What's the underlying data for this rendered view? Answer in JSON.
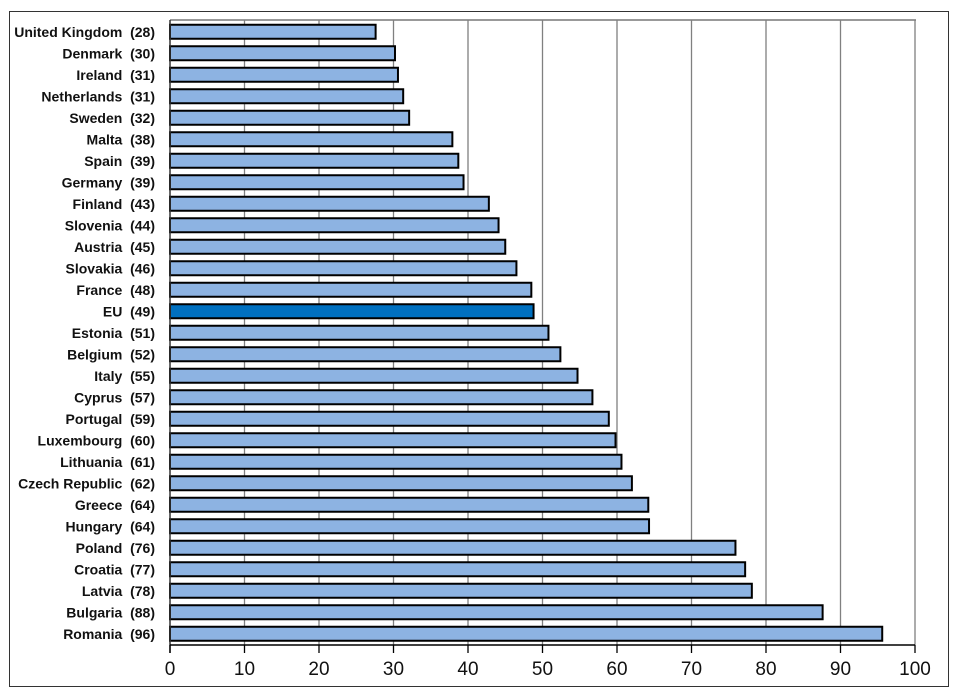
{
  "chart_data": {
    "type": "bar",
    "orientation": "horizontal",
    "title": "",
    "xlabel": "",
    "ylabel": "",
    "xlim": [
      0,
      100
    ],
    "xticks": [
      0,
      10,
      20,
      30,
      40,
      50,
      60,
      70,
      80,
      90,
      100
    ],
    "grid": "vertical",
    "legend": "none",
    "categories": [
      "United Kingdom  (28)",
      "Denmark  (30)",
      "Ireland  (31)",
      "Netherlands  (31)",
      "Sweden  (32)",
      "Malta  (38)",
      "Spain  (39)",
      "Germany  (39)",
      "Finland  (43)",
      "Slovenia  (44)",
      "Austria  (45)",
      "Slovakia  (46)",
      "France  (48)",
      "EU  (49)",
      "Estonia  (51)",
      "Belgium  (52)",
      "Italy  (55)",
      "Cyprus  (57)",
      "Portugal  (59)",
      "Luxembourg  (60)",
      "Lithuania  (61)",
      "Czech Republic  (62)",
      "Greece  (64)",
      "Hungary  (64)",
      "Poland  (76)",
      "Croatia  (77)",
      "Latvia  (78)",
      "Bulgaria  (88)",
      "Romania  (96)"
    ],
    "values": [
      27.6,
      30.2,
      30.6,
      31.3,
      32.1,
      37.9,
      38.7,
      39.4,
      42.8,
      44.1,
      45.0,
      46.5,
      48.5,
      48.8,
      50.8,
      52.4,
      54.7,
      56.7,
      58.9,
      59.8,
      60.6,
      62.0,
      64.2,
      64.3,
      75.9,
      77.2,
      78.1,
      87.6,
      95.6
    ],
    "highlight": "EU  (49)",
    "colors": {
      "bar": "#8db3e2",
      "highlight_bar": "#0070c0",
      "bar_edge": "#000000",
      "gridline": "#808080"
    }
  }
}
